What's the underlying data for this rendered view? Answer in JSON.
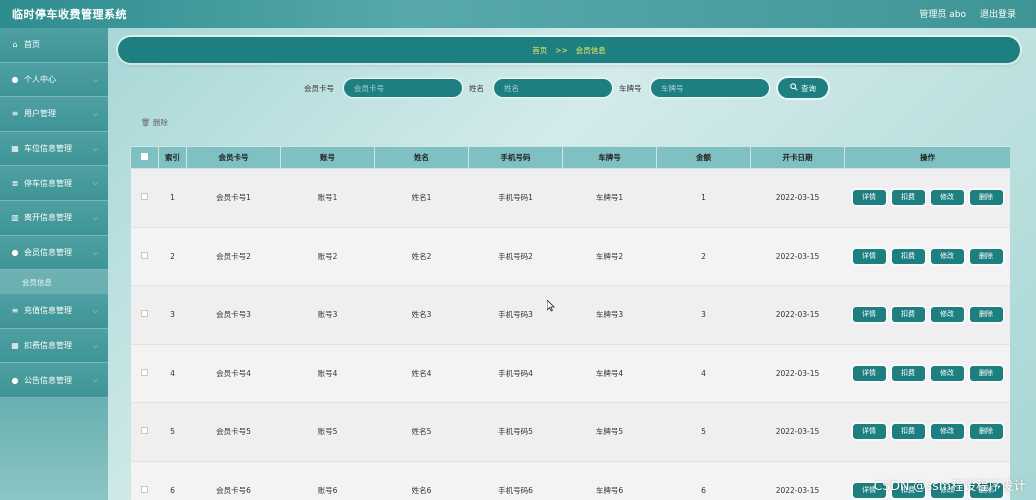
{
  "app": {
    "title": "临时停车收费管理系统",
    "user_label": "管理员 abo",
    "logout_label": "退出登录"
  },
  "sidebar": {
    "items": [
      {
        "label": "首页",
        "icon": "home-icon",
        "glyph": "⌂",
        "has_chevron": false
      },
      {
        "label": "个人中心",
        "icon": "person-icon",
        "glyph": "●",
        "has_chevron": true
      },
      {
        "label": "用户管理",
        "icon": "menu-icon",
        "glyph": "≡",
        "has_chevron": true
      },
      {
        "label": "车位信息管理",
        "icon": "grid-icon",
        "glyph": "▦",
        "has_chevron": true
      },
      {
        "label": "停车信息管理",
        "icon": "list-icon",
        "glyph": "≣",
        "has_chevron": true
      },
      {
        "label": "离开信息管理",
        "icon": "chart-icon",
        "glyph": "▥",
        "has_chevron": true
      },
      {
        "label": "会员信息管理",
        "icon": "person-icon",
        "glyph": "●",
        "has_chevron": true
      },
      {
        "label": "充值信息管理",
        "icon": "list-icon",
        "glyph": "≡",
        "has_chevron": true
      },
      {
        "label": "扣费信息管理",
        "icon": "grid-icon",
        "glyph": "▦",
        "has_chevron": true
      },
      {
        "label": "公告信息管理",
        "icon": "person-icon",
        "glyph": "●",
        "has_chevron": true
      }
    ],
    "active_sub": "会员信息"
  },
  "breadcrumb": {
    "home": "首页",
    "separator": ">>",
    "current": "会员信息"
  },
  "search": {
    "card_label": "会员卡号",
    "card_placeholder": "会员卡号",
    "name_label": "姓名",
    "name_placeholder": "姓名",
    "plate_label": "车牌号",
    "plate_placeholder": "车牌号",
    "button_label": "查询",
    "button_icon": "search-icon"
  },
  "actions": {
    "delete_label": "删除",
    "delete_icon": "trash-icon"
  },
  "table": {
    "headers": [
      "索引",
      "会员卡号",
      "账号",
      "姓名",
      "手机号码",
      "车牌号",
      "金额",
      "开卡日期",
      "操作"
    ],
    "op_labels": {
      "detail": "详情",
      "deduct": "扣费",
      "edit": "修改",
      "delete": "删除"
    },
    "rows": [
      {
        "index": "1",
        "card": "会员卡号1",
        "account": "账号1",
        "name": "姓名1",
        "phone": "手机号码1",
        "plate": "车牌号1",
        "amount": "1",
        "date": "2022-03-15"
      },
      {
        "index": "2",
        "card": "会员卡号2",
        "account": "账号2",
        "name": "姓名2",
        "phone": "手机号码2",
        "plate": "车牌号2",
        "amount": "2",
        "date": "2022-03-15"
      },
      {
        "index": "3",
        "card": "会员卡号3",
        "account": "账号3",
        "name": "姓名3",
        "phone": "手机号码3",
        "plate": "车牌号3",
        "amount": "3",
        "date": "2022-03-15"
      },
      {
        "index": "4",
        "card": "会员卡号4",
        "account": "账号4",
        "name": "姓名4",
        "phone": "手机号码4",
        "plate": "车牌号4",
        "amount": "4",
        "date": "2022-03-15"
      },
      {
        "index": "5",
        "card": "会员卡号5",
        "account": "账号5",
        "name": "姓名5",
        "phone": "手机号码5",
        "plate": "车牌号5",
        "amount": "5",
        "date": "2022-03-15"
      },
      {
        "index": "6",
        "card": "会员卡号6",
        "account": "账号6",
        "name": "姓名6",
        "phone": "手机号码6",
        "plate": "车牌号6",
        "amount": "6",
        "date": "2022-03-15"
      }
    ]
  },
  "watermark": "CSDN @ssm程设程序设计",
  "colors": {
    "accent": "#1e7f81",
    "header_row": "#7fc1c2",
    "crumb_text": "#f0f060"
  }
}
